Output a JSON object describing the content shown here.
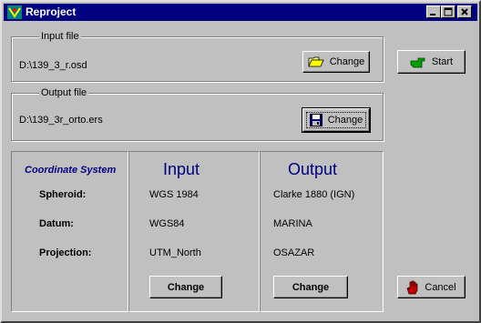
{
  "window": {
    "title": "Reproject"
  },
  "input_file": {
    "legend": "Input file",
    "path": "D:\\139_3_r.osd",
    "change_label": "Change"
  },
  "output_file": {
    "legend": "Output file",
    "path": "D:\\139_3r_orto.ers",
    "change_label": "Change"
  },
  "actions": {
    "start_label": "Start",
    "cancel_label": "Cancel"
  },
  "coordinate_system": {
    "title": "Coordinate System",
    "labels": {
      "spheroid": "Spheroid:",
      "datum": "Datum:",
      "projection": "Projection:"
    }
  },
  "input": {
    "header": "Input",
    "spheroid": "WGS 1984",
    "datum": "WGS84",
    "projection": "UTM_North",
    "change_label": "Change"
  },
  "output": {
    "header": "Output",
    "spheroid": "Clarke 1880 (IGN)",
    "datum": "MARINA",
    "projection": "OSAZAR",
    "change_label": "Change"
  },
  "colors": {
    "title_bar": "#000080",
    "face": "#c0c0c0",
    "header_text": "#000080",
    "start_icon": "#00a000",
    "cancel_icon": "#c00000"
  },
  "icons": [
    "app-icon",
    "minimize-icon",
    "maximize-icon",
    "close-icon",
    "folder-open-icon",
    "floppy-disk-icon",
    "hand-pointing-icon",
    "stop-hand-icon"
  ]
}
